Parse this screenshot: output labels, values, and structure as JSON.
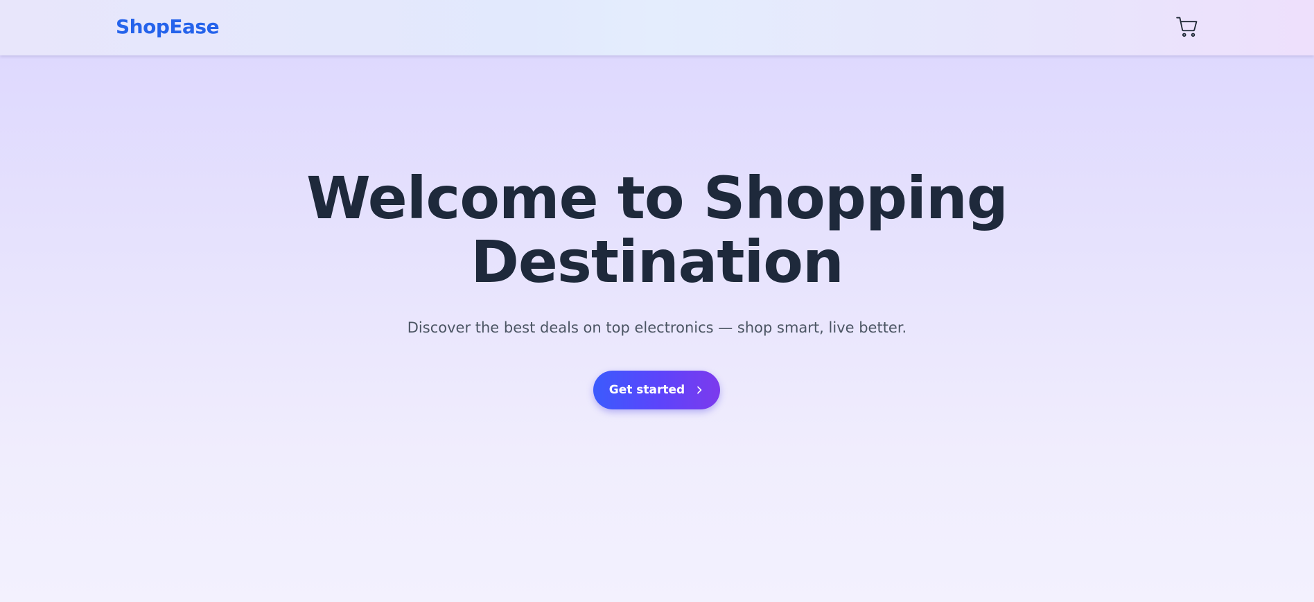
{
  "navbar": {
    "brand": "ShopEase",
    "cart_icon": "cart-icon"
  },
  "hero": {
    "title_line1": "Welcome to Shopping",
    "title_line2": "Destination",
    "subtitle": "Discover the best deals on top electronics — shop smart, live better.",
    "cta_label": "Get started",
    "cta_icon": "chevron-right-icon"
  },
  "colors": {
    "brand": "#2563eb",
    "heading": "#1e293b",
    "subtitle": "#4b5563",
    "cta_gradient_start": "#3b5bfd",
    "cta_gradient_end": "#7c3aed"
  }
}
